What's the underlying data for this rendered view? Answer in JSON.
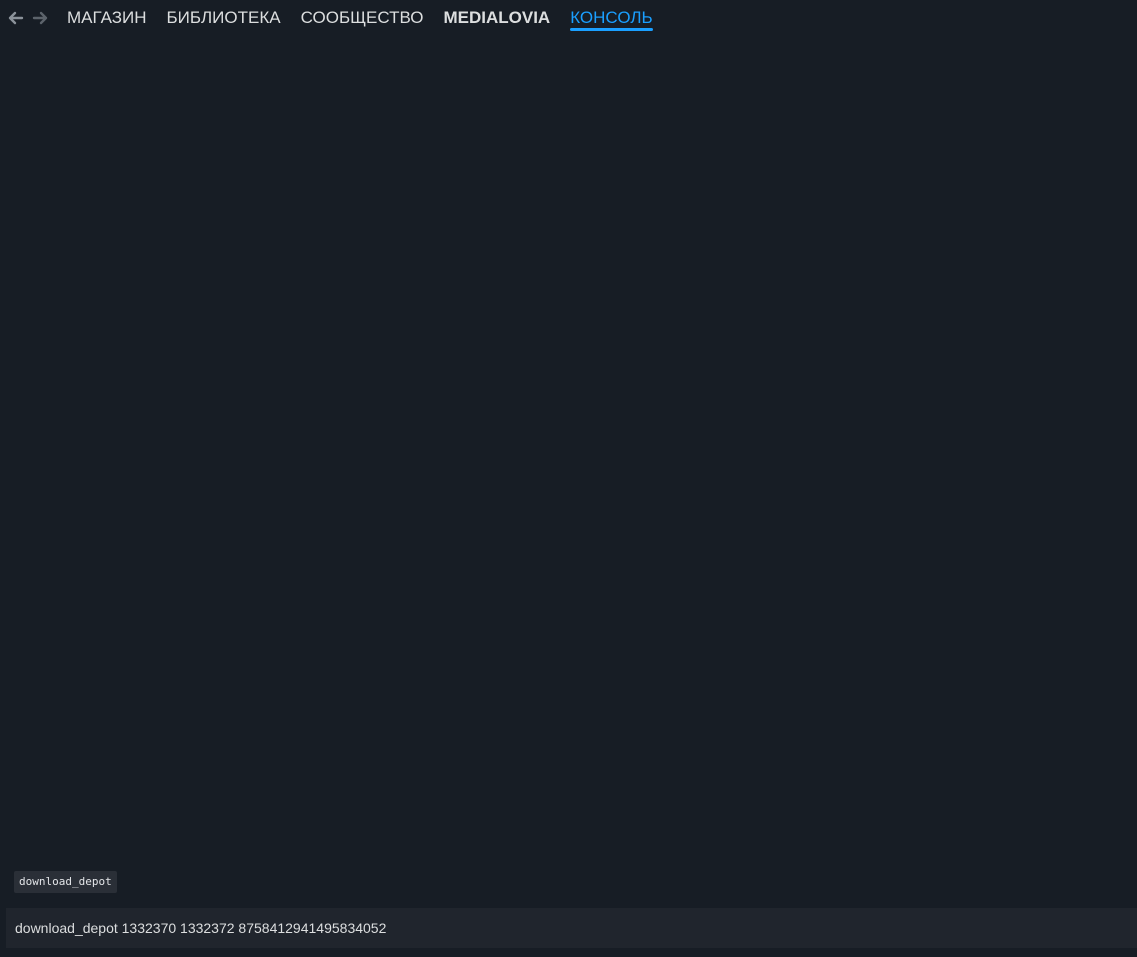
{
  "nav": {
    "back_icon": "arrow-left-icon",
    "forward_icon": "arrow-right-icon"
  },
  "tabs": [
    {
      "label": "МАГАЗИН",
      "bold": false,
      "active": false
    },
    {
      "label": "БИБЛИОТЕКА",
      "bold": false,
      "active": false
    },
    {
      "label": "СООБЩЕСТВО",
      "bold": false,
      "active": false
    },
    {
      "label": "MEDIALOVIA",
      "bold": true,
      "active": false
    },
    {
      "label": "КОНСОЛЬ",
      "bold": false,
      "active": true
    }
  ],
  "console": {
    "suggestion": "download_depot",
    "input_value": "download_depot 1332370 1332372 8758412941495834052"
  },
  "colors": {
    "background": "#171d25",
    "accent": "#1a9fff",
    "tab_text": "#dcdedf",
    "input_bg": "#20252d"
  }
}
